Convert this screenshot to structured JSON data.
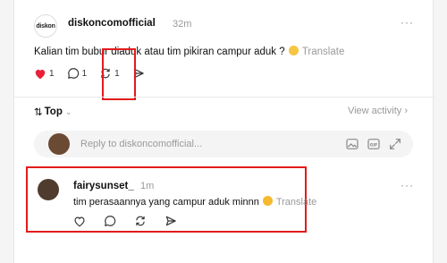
{
  "post": {
    "avatar_text": "diskon",
    "username": "diskoncomofficial",
    "time": "32m",
    "more": "···",
    "text": "Kalian tim bubur diaduk atau tim pikiran campur aduk ?",
    "translate": "Translate",
    "likes": "1",
    "comments": "1",
    "reposts": "1"
  },
  "sort": {
    "label": "Top",
    "view_activity": "View activity"
  },
  "reply": {
    "placeholder": "Reply to diskoncomofficial..."
  },
  "comment": {
    "username": "fairysunset_",
    "time": "1m",
    "more": "···",
    "text": "tim perasaannya yang campur aduk minnn",
    "translate": "Translate"
  },
  "colors": {
    "like": "#e8213b",
    "highlight": "#e21b1b"
  }
}
